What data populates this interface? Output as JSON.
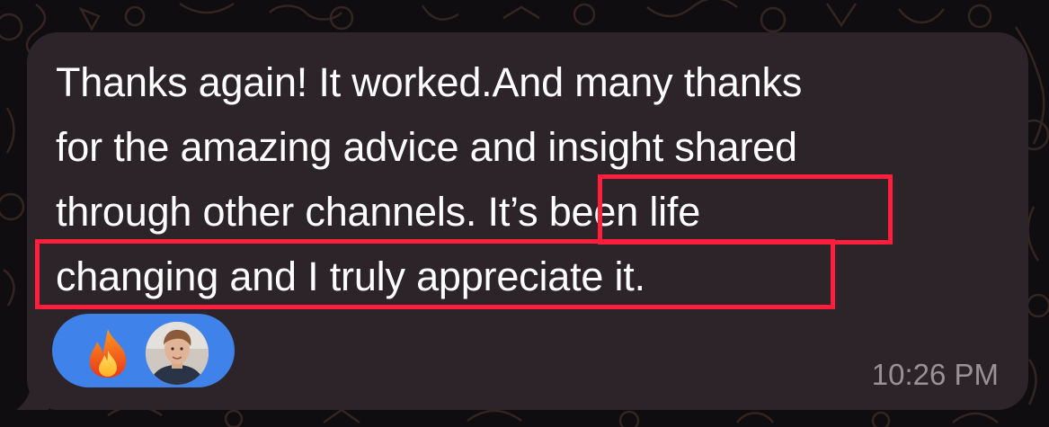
{
  "message": {
    "lines": [
      "Thanks again! It worked.And many thanks",
      "for the amazing advice and insight shared",
      "through other channels. It’s been life",
      "changing and I truly appreciate it."
    ],
    "timestamp": "10:26 PM",
    "highlight_color": "#ff1f3d"
  },
  "reactions": {
    "emoji": "fire",
    "reactor_avatar": "person-avatar",
    "pill_color": "#3f82e9"
  },
  "colors": {
    "bubble": "#2c2428",
    "background": "#0f0d10",
    "text": "#ffffff",
    "timestamp": "#9a9096"
  }
}
